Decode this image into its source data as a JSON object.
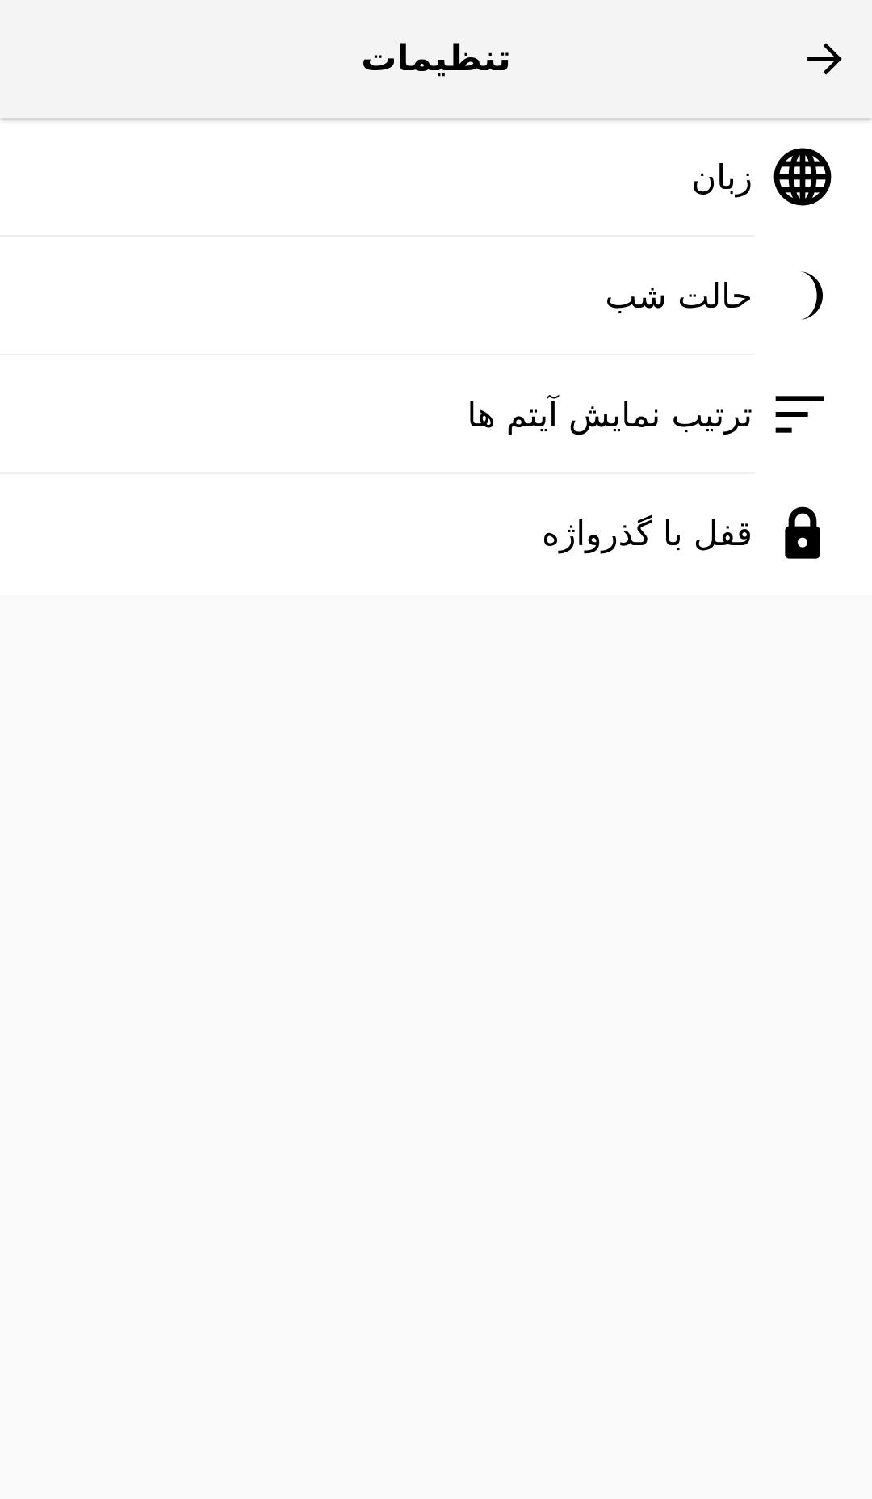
{
  "app_bar": {
    "title": "تنظیمات",
    "back_icon": "arrow-forward-icon"
  },
  "settings": {
    "items": [
      {
        "label": "زبان",
        "icon": "globe-icon"
      },
      {
        "label": "حالت شب",
        "icon": "moon-icon"
      },
      {
        "label": "ترتیب نمایش آیتم ها",
        "icon": "sort-icon"
      },
      {
        "label": "قفل با گذرواژه",
        "icon": "lock-icon"
      }
    ]
  },
  "colors": {
    "app_bar_background": "#f4f4f4",
    "list_background": "#ffffff",
    "page_background": "#fafafa",
    "text": "#000000"
  }
}
